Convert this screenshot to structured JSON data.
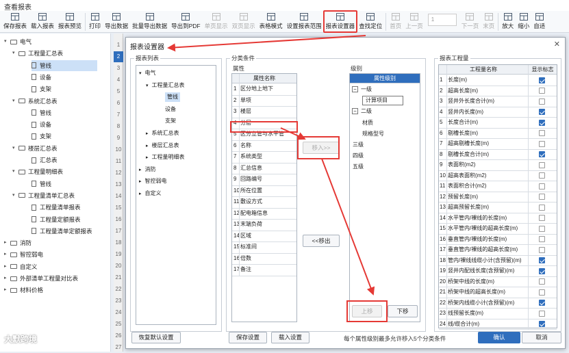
{
  "window": {
    "title": "查看报表"
  },
  "toolbar": [
    {
      "label": "保存报表",
      "icon": "grid-icon"
    },
    {
      "label": "载入报表",
      "icon": "folder-icon"
    },
    {
      "label": "报表预览",
      "icon": "preview-icon"
    },
    {
      "label": "打印",
      "icon": "printer-icon"
    },
    {
      "label": "导出数据",
      "icon": "export-icon"
    },
    {
      "label": "批量导出数据",
      "icon": "batch-export-icon"
    },
    {
      "label": "导出到PDF",
      "icon": "pdf-icon"
    },
    {
      "label": "单页显示",
      "icon": "single-page-icon",
      "disabled": true
    },
    {
      "label": "双页显示",
      "icon": "double-page-icon",
      "disabled": true
    },
    {
      "label": "表格模式",
      "icon": "table-mode-icon"
    },
    {
      "label": "设置报表范围",
      "icon": "range-icon"
    },
    {
      "label": "报表设置器",
      "icon": "settings-grid-icon",
      "highlight": true
    },
    {
      "label": "查找定位",
      "icon": "locate-icon"
    },
    {
      "label": "首页",
      "icon": "first-page-icon",
      "disabled": true
    },
    {
      "label": "上一页",
      "icon": "prev-page-icon",
      "disabled": true
    },
    {
      "label": "下一页",
      "icon": "next-page-icon",
      "disabled": true
    },
    {
      "label": "末页",
      "icon": "last-page-icon",
      "disabled": true
    },
    {
      "label": "放大",
      "icon": "zoom-in-icon"
    },
    {
      "label": "缩小",
      "icon": "zoom-out-icon"
    },
    {
      "label": "自适",
      "icon": "fit-icon"
    }
  ],
  "page_input": {
    "value": "1"
  },
  "left_tree": [
    {
      "label": "电气",
      "level": 0,
      "type": "folder",
      "arrow": "▾"
    },
    {
      "label": "工程量汇总表",
      "level": 1,
      "type": "folder",
      "arrow": "▾"
    },
    {
      "label": "管线",
      "level": 2,
      "type": "doc",
      "selected": true
    },
    {
      "label": "设备",
      "level": 2,
      "type": "doc"
    },
    {
      "label": "支架",
      "level": 2,
      "type": "doc"
    },
    {
      "label": "系统汇总表",
      "level": 1,
      "type": "folder",
      "arrow": "▾"
    },
    {
      "label": "管线",
      "level": 2,
      "type": "doc"
    },
    {
      "label": "设备",
      "level": 2,
      "type": "doc"
    },
    {
      "label": "支架",
      "level": 2,
      "type": "doc"
    },
    {
      "label": "楼层汇总表",
      "level": 1,
      "type": "folder",
      "arrow": "▾"
    },
    {
      "label": "汇总表",
      "level": 2,
      "type": "doc"
    },
    {
      "label": "工程量明细表",
      "level": 1,
      "type": "folder",
      "arrow": "▾"
    },
    {
      "label": "管线",
      "level": 2,
      "type": "doc"
    },
    {
      "label": "工程量清单汇总表",
      "level": 1,
      "type": "folder",
      "arrow": "▾"
    },
    {
      "label": "工程量清单报表",
      "level": 2,
      "type": "doc"
    },
    {
      "label": "工程量定额报表",
      "level": 2,
      "type": "doc"
    },
    {
      "label": "工程量清单定额报表",
      "level": 2,
      "type": "doc"
    },
    {
      "label": "消防",
      "level": 0,
      "type": "folder",
      "arrow": "▸"
    },
    {
      "label": "智控弱电",
      "level": 0,
      "type": "folder",
      "arrow": "▸"
    },
    {
      "label": "自定义",
      "level": 0,
      "type": "folder",
      "arrow": "▸"
    },
    {
      "label": "外部清单工程量对比表",
      "level": 0,
      "type": "folder",
      "arrow": "▸"
    },
    {
      "label": "材料价格",
      "level": 0,
      "type": "folder",
      "arrow": "▸"
    }
  ],
  "row_numbers": [
    "1",
    "2",
    "3",
    "4",
    "5",
    "6",
    "7",
    "8",
    "9",
    "10",
    "11",
    "12",
    "13",
    "14",
    "15",
    "16",
    "17",
    "18",
    "19",
    "20",
    "21",
    "22",
    "23",
    "24",
    "25",
    "26",
    "27"
  ],
  "dialog": {
    "title": "报表设置器",
    "close": "✕",
    "report_list": {
      "label": "报表列表",
      "items": [
        {
          "label": "电气",
          "level": 0,
          "arrow": "▾"
        },
        {
          "label": "工程量汇总表",
          "level": 1,
          "arrow": "▾"
        },
        {
          "label": "管线",
          "level": 2,
          "selected": true
        },
        {
          "label": "设备",
          "level": 2
        },
        {
          "label": "支架",
          "level": 2
        },
        {
          "label": "系统汇总表",
          "level": 1,
          "arrow": "▸"
        },
        {
          "label": "楼层汇总表",
          "level": 1,
          "arrow": "▸"
        },
        {
          "label": "工程量明细表",
          "level": 1,
          "arrow": "▸"
        },
        {
          "label": "消防",
          "level": 0,
          "arrow": "▸"
        },
        {
          "label": "智控弱电",
          "level": 0,
          "arrow": "▸"
        },
        {
          "label": "自定义",
          "level": 0,
          "arrow": "▸"
        }
      ]
    },
    "classify": {
      "label": "分类条件",
      "attr_label": "属性",
      "attr_header": "属性名称",
      "attributes": [
        "区分地上地下",
        "单项",
        "楼层",
        "分层",
        "区分立管与水平管",
        "名称",
        "系统类型",
        "汇总信息",
        "回路编号",
        "所在位置",
        "敷设方式",
        "配电箱信息",
        "末端负荷",
        "区域",
        "标准间",
        "倍数",
        "备注"
      ],
      "level_label": "级别",
      "level_header": "属性级别",
      "levels": [
        {
          "label": "一级",
          "type": "group"
        },
        {
          "label": "计算项目",
          "type": "child",
          "boxed": true
        },
        {
          "label": "二级",
          "type": "group"
        },
        {
          "label": "材质",
          "type": "child"
        },
        {
          "label": "规格型号",
          "type": "child"
        },
        {
          "label": "三级",
          "type": "plain"
        },
        {
          "label": "四级",
          "type": "plain"
        },
        {
          "label": "五级",
          "type": "plain"
        }
      ],
      "move_in": "移入>>",
      "move_out": "<<移出",
      "up": "上移",
      "down": "下移"
    },
    "quantity": {
      "label": "报表工程量",
      "header_name": "工程量名称",
      "header_show": "显示标志",
      "items": [
        {
          "name": "长度(m)",
          "show": true
        },
        {
          "name": "超高长度(m)",
          "show": false
        },
        {
          "name": "竖井外长度合计(m)",
          "show": false
        },
        {
          "name": "竖井内长度(m)",
          "show": true
        },
        {
          "name": "长度合计(m)",
          "show": true
        },
        {
          "name": "剔槽长度(m)",
          "show": false
        },
        {
          "name": "超高剔槽长度(m)",
          "show": false
        },
        {
          "name": "剔槽长度合计(m)",
          "show": true
        },
        {
          "name": "表面积(m2)",
          "show": false
        },
        {
          "name": "超高表面积(m2)",
          "show": false
        },
        {
          "name": "表面积合计(m2)",
          "show": false
        },
        {
          "name": "预留长度(m)",
          "show": false
        },
        {
          "name": "超高预留长度(m)",
          "show": false
        },
        {
          "name": "水平管内/裸线的长度(m)",
          "show": false
        },
        {
          "name": "水平管内/裸线的超高长度(m)",
          "show": false
        },
        {
          "name": "垂直管内/裸线的长度(m)",
          "show": false
        },
        {
          "name": "垂直管内/裸线的超高长度(m)",
          "show": false
        },
        {
          "name": "管内/裸线线缆小计(含预留)(m)",
          "show": true
        },
        {
          "name": "竖井内配线长度(含预留)(m)",
          "show": true
        },
        {
          "name": "桥架中线的长度(m)",
          "show": false
        },
        {
          "name": "桥架中线的超高长度(m)",
          "show": false
        },
        {
          "name": "桥架内线缆小计(含预留)(m)",
          "show": true
        },
        {
          "name": "线预留长度(m)",
          "show": false
        },
        {
          "name": "线/缆合计(m)",
          "show": true
        }
      ]
    },
    "footer": {
      "restore": "恢复默认设置",
      "save": "保存设置",
      "load": "载入设置",
      "note": "每个属性级别最多允许移入5个分类条件",
      "ok": "确认",
      "cancel": "取消"
    }
  },
  "watermark": "大默跨境",
  "colors": {
    "accent": "#2f6ebd",
    "highlight": "#e53935"
  }
}
